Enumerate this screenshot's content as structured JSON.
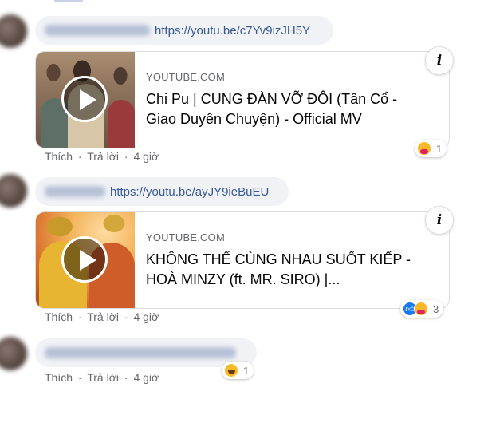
{
  "comments": [
    {
      "link": "https://youtu.be/c7Yv9izJH5Y",
      "card": {
        "domain": "YOUTUBE.COM",
        "title": "Chi Pu | CUNG ĐÀN VỠ ĐÔI (Tân Cổ - Giao Duyên Chuyện) - Official MV"
      },
      "actions": {
        "like": "Thích",
        "reply": "Trả lời",
        "time": "4 giờ"
      },
      "reactions": {
        "icons": [
          "care"
        ],
        "count": "1"
      }
    },
    {
      "link": "https://youtu.be/ayJY9ieBuEU",
      "card": {
        "domain": "YOUTUBE.COM",
        "title": "KHÔNG THỂ CÙNG NHAU SUỐT KIẾP - HOÀ MINZY (ft. MR. SIRO) |..."
      },
      "actions": {
        "like": "Thích",
        "reply": "Trả lời",
        "time": "4 giờ"
      },
      "reactions": {
        "icons": [
          "like",
          "care"
        ],
        "count": "3"
      }
    },
    {
      "actions": {
        "like": "Thích",
        "reply": "Trả lời",
        "time": "4 giờ"
      },
      "reactions": {
        "icons": [
          "haha"
        ],
        "count": "1"
      }
    }
  ],
  "info_icon": "i",
  "separator": "·"
}
